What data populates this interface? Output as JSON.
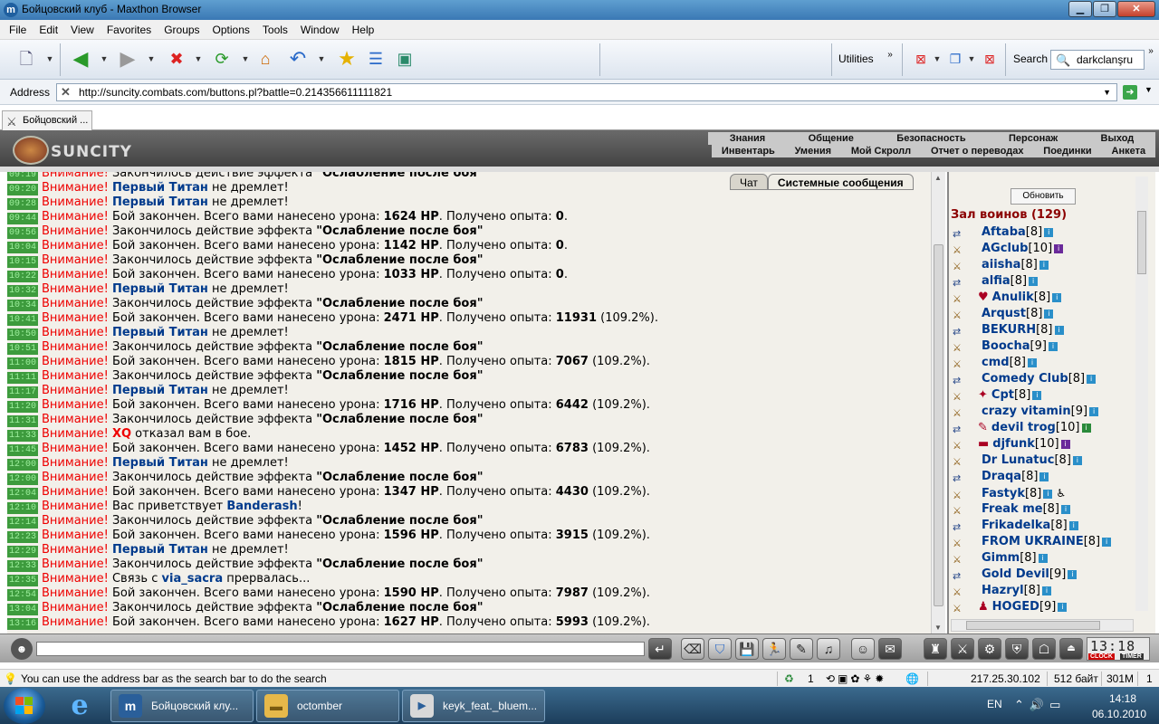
{
  "window": {
    "title": "Бойцовский клуб - Maxthon Browser",
    "app_icon": "m"
  },
  "menu": [
    "File",
    "Edit",
    "View",
    "Favorites",
    "Groups",
    "Options",
    "Tools",
    "Window",
    "Help"
  ],
  "toolbar": {
    "utilities": "Utilities",
    "search_label": "Search",
    "search_value": "darkclanşru"
  },
  "address": {
    "label": "Address",
    "url": "http://suncity.combats.com/buttons.pl?battle=0.214356611111821"
  },
  "tab": {
    "label": "Бойцовский ..."
  },
  "game": {
    "logo": "SUNCITY",
    "topnav": [
      "Знания",
      "Общение",
      "Безопасность",
      "Персонаж",
      "Выход"
    ],
    "subnav": [
      "Инвентарь",
      "Умения",
      "Мой Скролл",
      "Отчет о переводах",
      "Поединки",
      "Анкета"
    ]
  },
  "chat_tabs": [
    "Чат",
    "Системные сообщения"
  ],
  "chat": [
    {
      "t": "09:19",
      "parts": [
        [
          "warn",
          "Внимание!"
        ],
        [
          "n",
          " Закончилось действие эффекта "
        ],
        [
          "b",
          "\"Ослабление после боя\""
        ]
      ]
    },
    {
      "t": "09:20",
      "parts": [
        [
          "warn",
          "Внимание!"
        ],
        [
          "n",
          " "
        ],
        [
          "nick",
          "Первый Титан"
        ],
        [
          "n",
          " не дремлет!"
        ]
      ]
    },
    {
      "t": "09:28",
      "parts": [
        [
          "warn",
          "Внимание!"
        ],
        [
          "n",
          " "
        ],
        [
          "nick",
          "Первый Титан"
        ],
        [
          "n",
          " не дремлет!"
        ]
      ]
    },
    {
      "t": "09:44",
      "parts": [
        [
          "warn",
          "Внимание!"
        ],
        [
          "n",
          " Бой закончен. Всего вами нанесено урона: "
        ],
        [
          "b",
          "1624 HP"
        ],
        [
          "n",
          ". Получено опыта: "
        ],
        [
          "b",
          "0"
        ],
        [
          "n",
          "."
        ]
      ]
    },
    {
      "t": "09:56",
      "parts": [
        [
          "warn",
          "Внимание!"
        ],
        [
          "n",
          " Закончилось действие эффекта "
        ],
        [
          "b",
          "\"Ослабление после боя\""
        ]
      ]
    },
    {
      "t": "10:04",
      "parts": [
        [
          "warn",
          "Внимание!"
        ],
        [
          "n",
          " Бой закончен. Всего вами нанесено урона: "
        ],
        [
          "b",
          "1142 HP"
        ],
        [
          "n",
          ". Получено опыта: "
        ],
        [
          "b",
          "0"
        ],
        [
          "n",
          "."
        ]
      ]
    },
    {
      "t": "10:15",
      "parts": [
        [
          "warn",
          "Внимание!"
        ],
        [
          "n",
          " Закончилось действие эффекта "
        ],
        [
          "b",
          "\"Ослабление после боя\""
        ]
      ]
    },
    {
      "t": "10:22",
      "parts": [
        [
          "warn",
          "Внимание!"
        ],
        [
          "n",
          " Бой закончен. Всего вами нанесено урона: "
        ],
        [
          "b",
          "1033 HP"
        ],
        [
          "n",
          ". Получено опыта: "
        ],
        [
          "b",
          "0"
        ],
        [
          "n",
          "."
        ]
      ]
    },
    {
      "t": "10:32",
      "parts": [
        [
          "warn",
          "Внимание!"
        ],
        [
          "n",
          " "
        ],
        [
          "nick",
          "Первый Титан"
        ],
        [
          "n",
          " не дремлет!"
        ]
      ]
    },
    {
      "t": "10:34",
      "parts": [
        [
          "warn",
          "Внимание!"
        ],
        [
          "n",
          " Закончилось действие эффекта "
        ],
        [
          "b",
          "\"Ослабление после боя\""
        ]
      ]
    },
    {
      "t": "10:41",
      "parts": [
        [
          "warn",
          "Внимание!"
        ],
        [
          "n",
          " Бой закончен. Всего вами нанесено урона: "
        ],
        [
          "b",
          "2471 HP"
        ],
        [
          "n",
          ". Получено опыта: "
        ],
        [
          "b",
          "11931"
        ],
        [
          "n",
          " (109.2%)."
        ]
      ]
    },
    {
      "t": "10:50",
      "parts": [
        [
          "warn",
          "Внимание!"
        ],
        [
          "n",
          " "
        ],
        [
          "nick",
          "Первый Титан"
        ],
        [
          "n",
          " не дремлет!"
        ]
      ]
    },
    {
      "t": "10:51",
      "parts": [
        [
          "warn",
          "Внимание!"
        ],
        [
          "n",
          " Закончилось действие эффекта "
        ],
        [
          "b",
          "\"Ослабление после боя\""
        ]
      ]
    },
    {
      "t": "11:00",
      "parts": [
        [
          "warn",
          "Внимание!"
        ],
        [
          "n",
          " Бой закончен. Всего вами нанесено урона: "
        ],
        [
          "b",
          "1815 HP"
        ],
        [
          "n",
          ". Получено опыта: "
        ],
        [
          "b",
          "7067"
        ],
        [
          "n",
          " (109.2%)."
        ]
      ]
    },
    {
      "t": "11:11",
      "parts": [
        [
          "warn",
          "Внимание!"
        ],
        [
          "n",
          " Закончилось действие эффекта "
        ],
        [
          "b",
          "\"Ослабление после боя\""
        ]
      ]
    },
    {
      "t": "11:17",
      "parts": [
        [
          "warn",
          "Внимание!"
        ],
        [
          "n",
          " "
        ],
        [
          "nick",
          "Первый Титан"
        ],
        [
          "n",
          " не дремлет!"
        ]
      ]
    },
    {
      "t": "11:20",
      "parts": [
        [
          "warn",
          "Внимание!"
        ],
        [
          "n",
          " Бой закончен. Всего вами нанесено урона: "
        ],
        [
          "b",
          "1716 HP"
        ],
        [
          "n",
          ". Получено опыта: "
        ],
        [
          "b",
          "6442"
        ],
        [
          "n",
          " (109.2%)."
        ]
      ]
    },
    {
      "t": "11:31",
      "parts": [
        [
          "warn",
          "Внимание!"
        ],
        [
          "n",
          " Закончилось действие эффекта "
        ],
        [
          "b",
          "\"Ослабление после боя\""
        ]
      ]
    },
    {
      "t": "11:33",
      "parts": [
        [
          "warn",
          "Внимание!"
        ],
        [
          "n",
          " "
        ],
        [
          "nickred",
          "XQ"
        ],
        [
          "n",
          " отказал вам в бое."
        ]
      ]
    },
    {
      "t": "11:45",
      "parts": [
        [
          "warn",
          "Внимание!"
        ],
        [
          "n",
          " Бой закончен. Всего вами нанесено урона: "
        ],
        [
          "b",
          "1452 HP"
        ],
        [
          "n",
          ". Получено опыта: "
        ],
        [
          "b",
          "6783"
        ],
        [
          "n",
          " (109.2%)."
        ]
      ]
    },
    {
      "t": "12:00",
      "parts": [
        [
          "warn",
          "Внимание!"
        ],
        [
          "n",
          " "
        ],
        [
          "nick",
          "Первый Титан"
        ],
        [
          "n",
          " не дремлет!"
        ]
      ]
    },
    {
      "t": "12:00",
      "parts": [
        [
          "warn",
          "Внимание!"
        ],
        [
          "n",
          " Закончилось действие эффекта "
        ],
        [
          "b",
          "\"Ослабление после боя\""
        ]
      ]
    },
    {
      "t": "12:04",
      "parts": [
        [
          "warn",
          "Внимание!"
        ],
        [
          "n",
          " Бой закончен. Всего вами нанесено урона: "
        ],
        [
          "b",
          "1347 HP"
        ],
        [
          "n",
          ". Получено опыта: "
        ],
        [
          "b",
          "4430"
        ],
        [
          "n",
          " (109.2%)."
        ]
      ]
    },
    {
      "t": "12:10",
      "parts": [
        [
          "warn",
          "Внимание!"
        ],
        [
          "n",
          " Вас приветствует "
        ],
        [
          "nick",
          "Banderash"
        ],
        [
          "n",
          "!"
        ]
      ]
    },
    {
      "t": "12:14",
      "parts": [
        [
          "warn",
          "Внимание!"
        ],
        [
          "n",
          " Закончилось действие эффекта "
        ],
        [
          "b",
          "\"Ослабление после боя\""
        ]
      ]
    },
    {
      "t": "12:23",
      "parts": [
        [
          "warn",
          "Внимание!"
        ],
        [
          "n",
          " Бой закончен. Всего вами нанесено урона: "
        ],
        [
          "b",
          "1596 HP"
        ],
        [
          "n",
          ". Получено опыта: "
        ],
        [
          "b",
          "3915"
        ],
        [
          "n",
          " (109.2%)."
        ]
      ]
    },
    {
      "t": "12:29",
      "parts": [
        [
          "warn",
          "Внимание!"
        ],
        [
          "n",
          " "
        ],
        [
          "nick",
          "Первый Титан"
        ],
        [
          "n",
          " не дремлет!"
        ]
      ]
    },
    {
      "t": "12:33",
      "parts": [
        [
          "warn",
          "Внимание!"
        ],
        [
          "n",
          " Закончилось действие эффекта "
        ],
        [
          "b",
          "\"Ослабление после боя\""
        ]
      ]
    },
    {
      "t": "12:35",
      "parts": [
        [
          "warn",
          "Внимание!"
        ],
        [
          "n",
          " Связь с "
        ],
        [
          "nick",
          "via_sacra"
        ],
        [
          "n",
          " прервалась..."
        ]
      ]
    },
    {
      "t": "12:54",
      "parts": [
        [
          "warn",
          "Внимание!"
        ],
        [
          "n",
          " Бой закончен. Всего вами нанесено урона: "
        ],
        [
          "b",
          "1590 HP"
        ],
        [
          "n",
          ". Получено опыта: "
        ],
        [
          "b",
          "7987"
        ],
        [
          "n",
          " (109.2%)."
        ]
      ]
    },
    {
      "t": "13:04",
      "parts": [
        [
          "warn",
          "Внимание!"
        ],
        [
          "n",
          " Закончилось действие эффекта "
        ],
        [
          "b",
          "\"Ослабление после боя\""
        ]
      ]
    },
    {
      "t": "13:16",
      "parts": [
        [
          "warn",
          "Внимание!"
        ],
        [
          "n",
          " Бой закончен. Всего вами нанесено урона: "
        ],
        [
          "b",
          "1627 HP"
        ],
        [
          "n",
          ". Получено опыта: "
        ],
        [
          "b",
          "5993"
        ],
        [
          "n",
          " (109.2%)."
        ]
      ]
    }
  ],
  "panel": {
    "refresh": "Обновить",
    "hall_title": "Зал воинов (129)",
    "users": [
      {
        "name": "Aftaba",
        "lvl": "[8]",
        "info": "i"
      },
      {
        "name": "AGclub",
        "lvl": "[10]",
        "info": "i",
        "infoColor": "pur"
      },
      {
        "name": "aiisha",
        "lvl": "[8]",
        "info": "i"
      },
      {
        "name": "alfia",
        "lvl": "[8]",
        "info": "i"
      },
      {
        "name": "Anulik",
        "lvl": "[8]",
        "info": "i",
        "badge": "♥"
      },
      {
        "name": "Arqust",
        "lvl": "[8]",
        "info": "i"
      },
      {
        "name": "BEKURH",
        "lvl": "[8]",
        "info": "i"
      },
      {
        "name": "Boocha",
        "lvl": "[9]",
        "info": "i"
      },
      {
        "name": "cmd",
        "lvl": "[8]",
        "info": "i"
      },
      {
        "name": "Comedy Club",
        "lvl": "[8]",
        "info": "i"
      },
      {
        "name": "Cpt",
        "lvl": "[8]",
        "info": "i",
        "badge": "✦"
      },
      {
        "name": "crazy vitamin",
        "lvl": "[9]",
        "info": "i"
      },
      {
        "name": "devil trog",
        "lvl": "[10]",
        "info": "i",
        "infoColor": "grn",
        "badge": "✎"
      },
      {
        "name": "djfunk",
        "lvl": "[10]",
        "info": "i",
        "infoColor": "pur",
        "badge": "▬"
      },
      {
        "name": "Dr Lunatuc",
        "lvl": "[8]",
        "info": "i"
      },
      {
        "name": "Draqa",
        "lvl": "[8]",
        "info": "i"
      },
      {
        "name": "Fastyk",
        "lvl": "[8]",
        "info": "i",
        "extra": "♿"
      },
      {
        "name": "Freak me",
        "lvl": "[8]",
        "info": "i"
      },
      {
        "name": "Frikadelka",
        "lvl": "[8]",
        "info": "i"
      },
      {
        "name": "FROM UKRAINE",
        "lvl": "[8]",
        "info": "i"
      },
      {
        "name": "Gimm",
        "lvl": "[8]",
        "info": "i"
      },
      {
        "name": "Gold Devil",
        "lvl": "[9]",
        "info": "i"
      },
      {
        "name": "Hazryl",
        "lvl": "[8]",
        "info": "i"
      },
      {
        "name": "HOGED",
        "lvl": "[9]",
        "info": "i",
        "badge": "♟"
      }
    ]
  },
  "clock": {
    "time": "13:18",
    "label1": "CLOCK",
    "label2": "TIMER"
  },
  "status": {
    "tip": "You can use the address bar as the search bar to do the search",
    "count": "1",
    "ip": "217.25.30.102",
    "bytes": "512 байт",
    "mem": "301M",
    "num": "1"
  },
  "taskbar": {
    "apps": [
      "Бойцовский клу...",
      "octomber",
      "keyk_feat._bluem..."
    ],
    "lang": "EN",
    "time": "14:18",
    "date": "06.10.2010"
  }
}
